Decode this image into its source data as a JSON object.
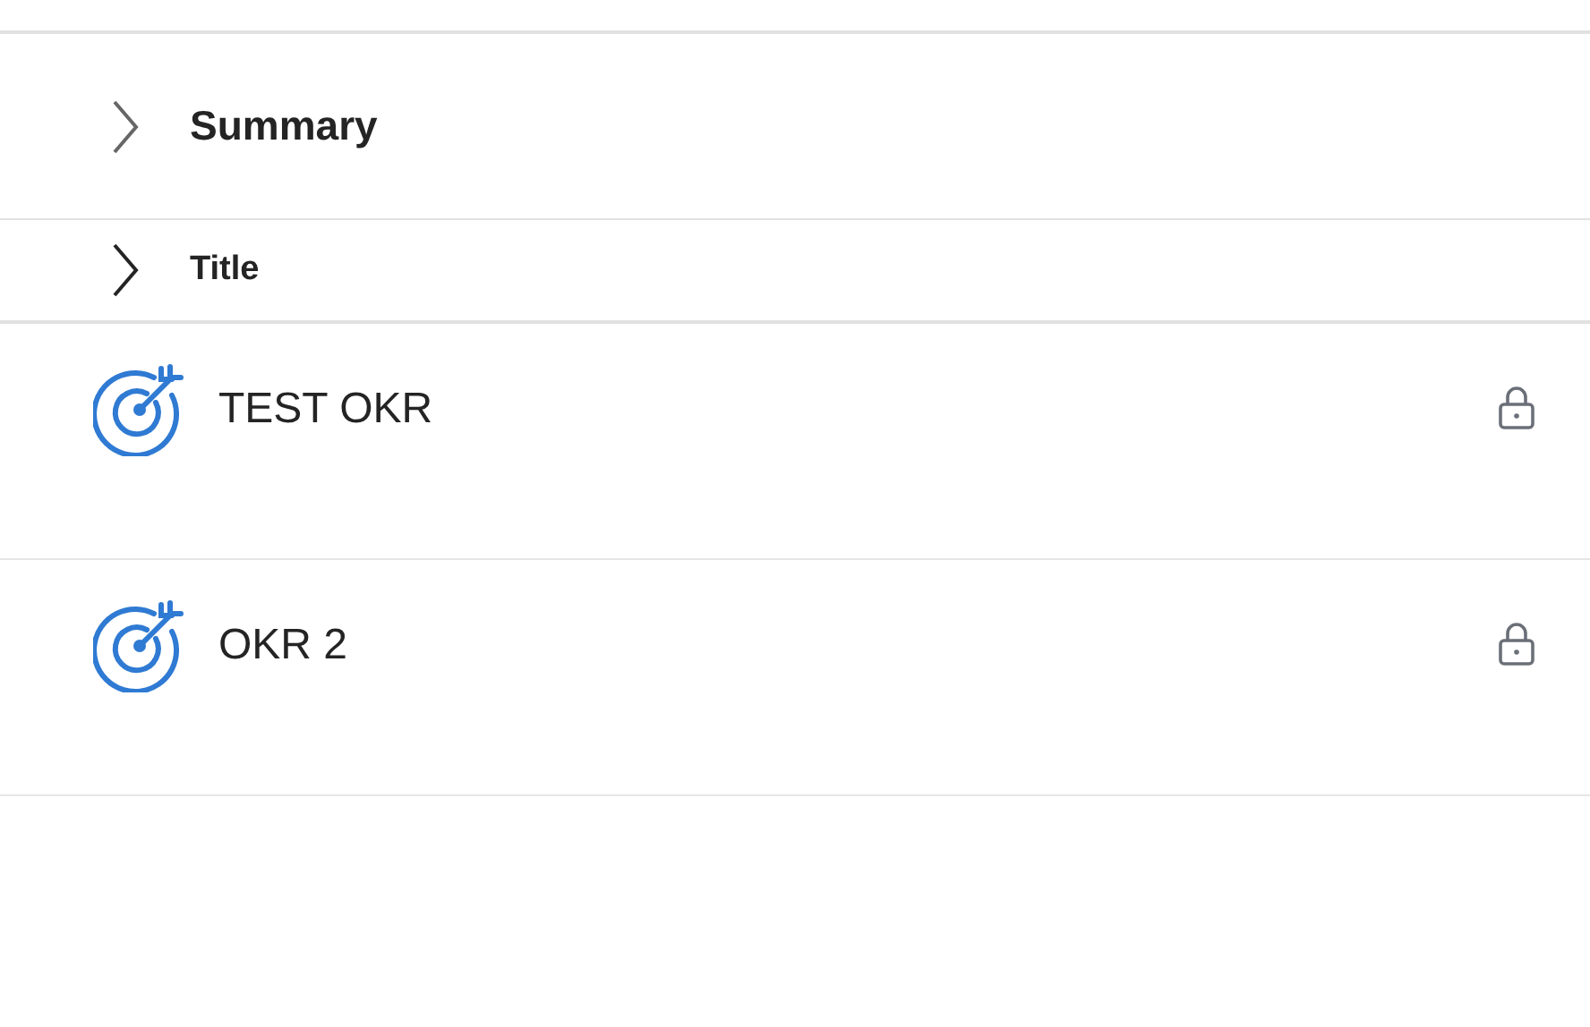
{
  "sections": [
    {
      "label": "Summary",
      "expanded": false
    },
    {
      "label": "Title",
      "expanded": false
    }
  ],
  "okrs": [
    {
      "title": "TEST OKR",
      "locked": true
    },
    {
      "title": "OKR 2",
      "locked": true
    }
  ]
}
